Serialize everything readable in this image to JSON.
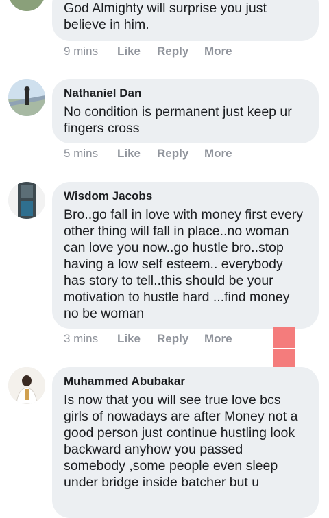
{
  "comments": [
    {
      "author": "",
      "text": "God Almighty will surprise you just believe in him.",
      "time": "9 mins",
      "like": "Like",
      "reply": "Reply",
      "more": "More"
    },
    {
      "author": "Nathaniel Dan",
      "text": "No condition is permanent just keep ur fingers cross",
      "time": "5 mins",
      "like": "Like",
      "reply": "Reply",
      "more": "More"
    },
    {
      "author": "Wisdom Jacobs",
      "text": "Bro..go fall in love with money first every other thing will fall in place..no woman can love you now..go hustle bro..stop having a low self esteem.. everybody has story to tell..this should be your motivation to hustle hard ...find money no be woman",
      "time": "3 mins",
      "like": "Like",
      "reply": "Reply",
      "more": "More"
    },
    {
      "author": "Muhammed Abubakar",
      "text": "Is now that you will see true love bcs girls of nowadays are after Money not a good person just continue hustling look backward anyhow you passed somebody ,some people even sleep under bridge inside batcher but u"
    }
  ],
  "colors": {
    "bubble": "#eceff2",
    "name": "#1c1e21",
    "meta": "#90949c",
    "overlay": "#f47c7c"
  }
}
